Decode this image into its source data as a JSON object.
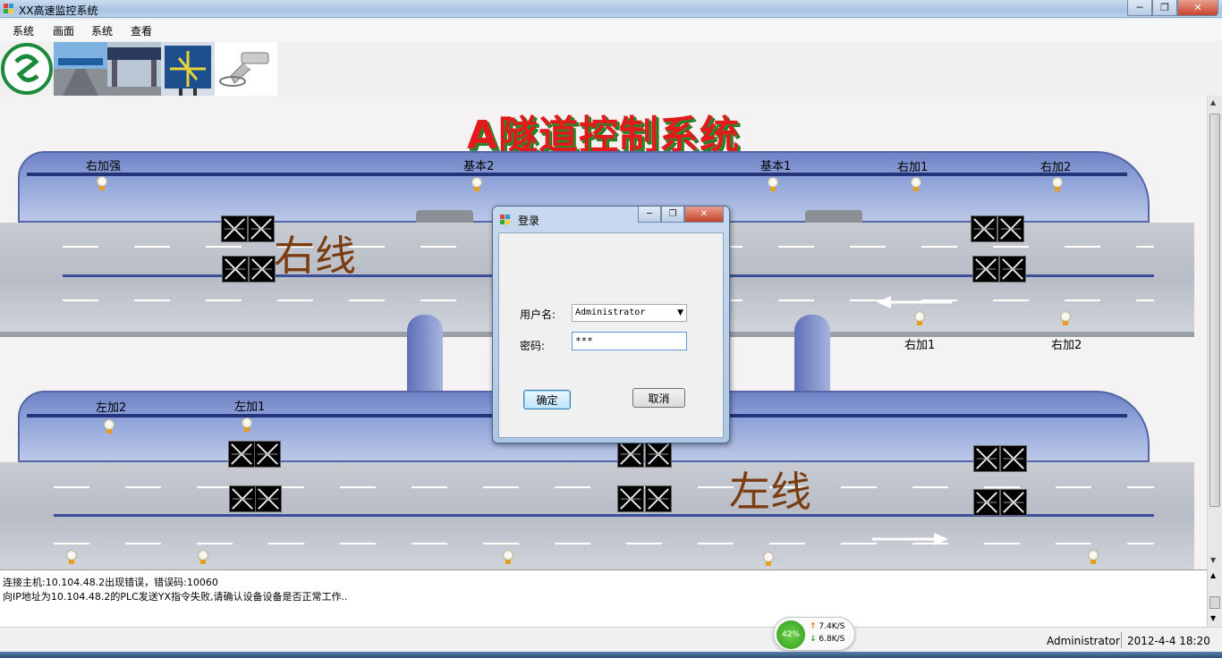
{
  "window": {
    "title": "XX高速监控系统"
  },
  "menu": [
    "系统",
    "画面",
    "系统",
    "查看"
  ],
  "canvas": {
    "title": "A隧道控制系统",
    "right_line_label": "右线",
    "left_line_label": "左线",
    "upper_lamps": [
      "右加强",
      "基本2",
      "基本1",
      "右加1",
      "右加2"
    ],
    "upper_lower_lamps": [
      "右加1",
      "右加2"
    ],
    "lower_lamps": [
      "左加2",
      "左加1"
    ]
  },
  "login_dialog": {
    "title": "登录",
    "username_label": "用户名:",
    "username_value": "Administrator",
    "password_label": "密码:",
    "password_value": "***",
    "ok_label": "确定",
    "cancel_label": "取消"
  },
  "log": {
    "lines": [
      "连接主机:10.104.48.2出现错误，错误码:10060",
      "向IP地址为10.104.48.2的PLC发送YX指令失败,请确认设备设备是否正常工作.."
    ]
  },
  "status": {
    "user": "Administrator",
    "datetime": "2012-4-4 18:20"
  },
  "netmon": {
    "percent": "42%",
    "upload": "7.4K/S",
    "download": "6.8K/S"
  }
}
